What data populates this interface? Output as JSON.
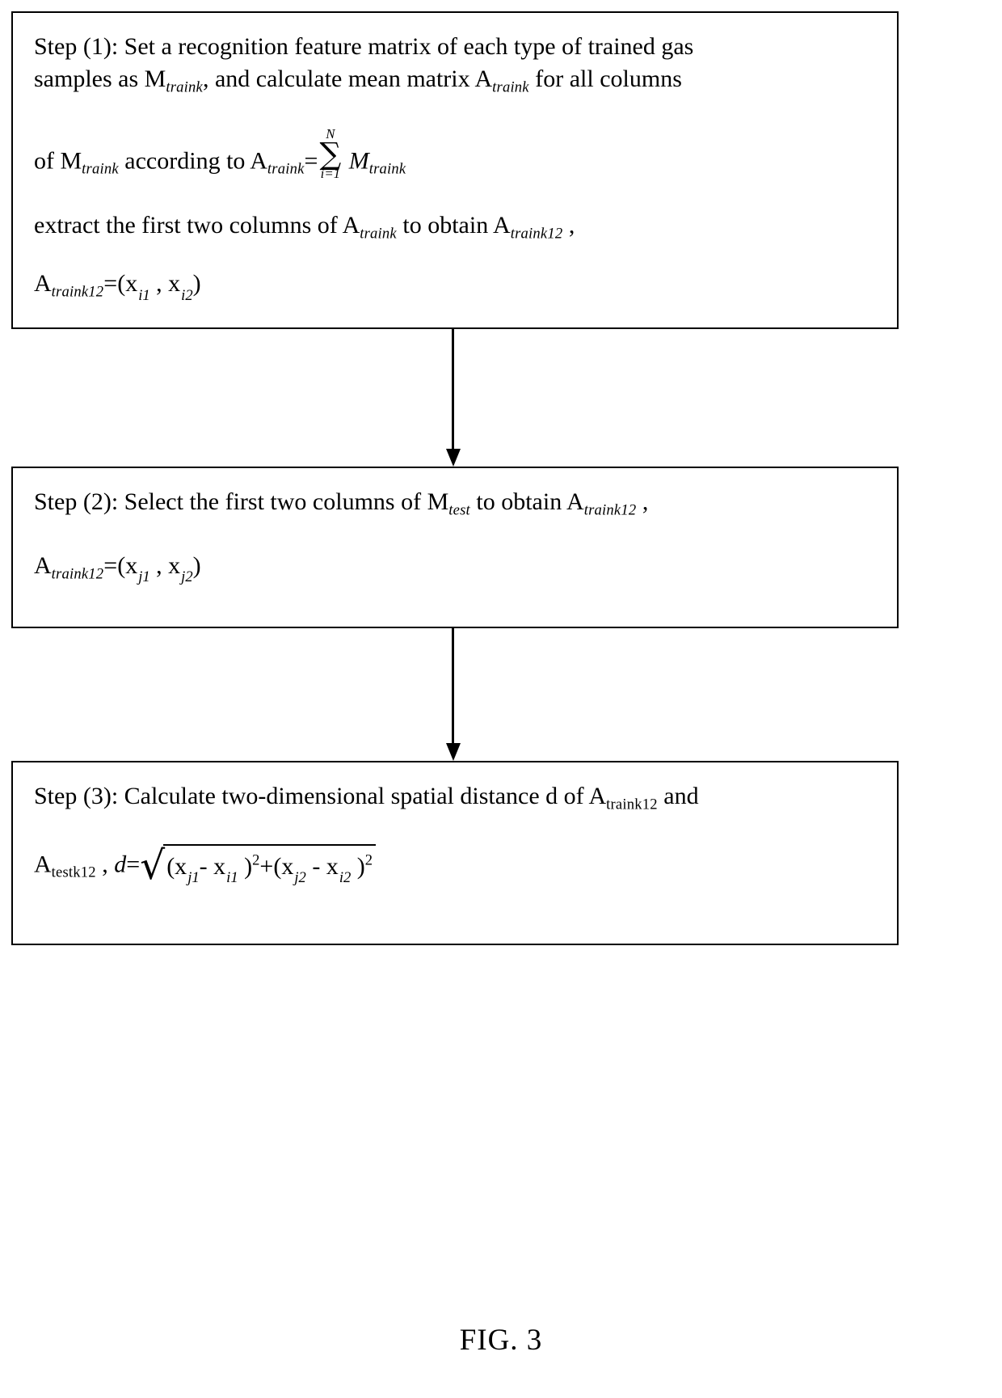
{
  "figure": {
    "caption": "FIG. 3"
  },
  "steps": [
    {
      "id": "step-1",
      "label": "Step (1):",
      "line1_a": "Step (1): Set a recognition feature matrix of each type of trained gas",
      "line2_a": "samples as M",
      "line2_sub1": "traink",
      "line2_b": ", and calculate mean matrix A",
      "line2_sub2": "traink",
      "line2_c": " for all columns",
      "line3_a": "of M",
      "line3_sub1": "traink",
      "line3_b": " according to A",
      "line3_sub2": "traink",
      "line3_eq": "=",
      "sum_upper": "N",
      "sum_symbol": "∑",
      "sum_lower": "i=1",
      "line3_c": "M",
      "line3_sub3": "traink",
      "line4_a": "extract the first two columns of A",
      "line4_sub1": "traink",
      "line4_b": " to obtain A",
      "line4_sub2": "traink12",
      "line4_c": " ,",
      "line5_a": "A",
      "line5_sub1": "traink12",
      "line5_eq": "=(x",
      "line5_sub2": "i1",
      "line5_comma": " , x",
      "line5_sub3": "i2",
      "line5_close": ")"
    },
    {
      "id": "step-2",
      "label": "Step (2):",
      "line1_a": "Step (2): Select the first two columns of M",
      "line1_sub1": "test",
      "line1_b": " to obtain A",
      "line1_sub2": "traink12",
      "line1_c": " ,",
      "line2_a": "A",
      "line2_sub1": "traink12",
      "line2_eq": "=(x",
      "line2_sub2": "j1",
      "line2_comma": " , x",
      "line2_sub3": "j2",
      "line2_close": ")"
    },
    {
      "id": "step-3",
      "label": "Step (3):",
      "line1_a": "Step (3): Calculate two-dimensional spatial distance d of A",
      "line1_sub1": "traink12",
      "line1_b": " and",
      "line2_a": "A",
      "line2_sub1": "testk12",
      "line2_b": " , ",
      "line2_d": "d",
      "line2_eq": "=",
      "radical_sign": "√",
      "r_open1": "(x",
      "r_sub_j1": "j1",
      "r_minus1": "- x",
      "r_sub_i1": "i1",
      "r_close1": " )",
      "r_pow1": "2",
      "r_plus": "+(x",
      "r_sub_j2": "j2",
      "r_minus2": " - x",
      "r_sub_i2": "i2",
      "r_close2": " )",
      "r_pow2": "2"
    }
  ],
  "connectors": [
    {
      "id": "connector-1-2",
      "from": "step-1",
      "to": "step-2",
      "direction": "down"
    },
    {
      "id": "connector-2-3",
      "from": "step-2",
      "to": "step-3",
      "direction": "down"
    }
  ],
  "colors": {
    "stroke": "#000000",
    "background": "#ffffff",
    "text": "#000000"
  }
}
